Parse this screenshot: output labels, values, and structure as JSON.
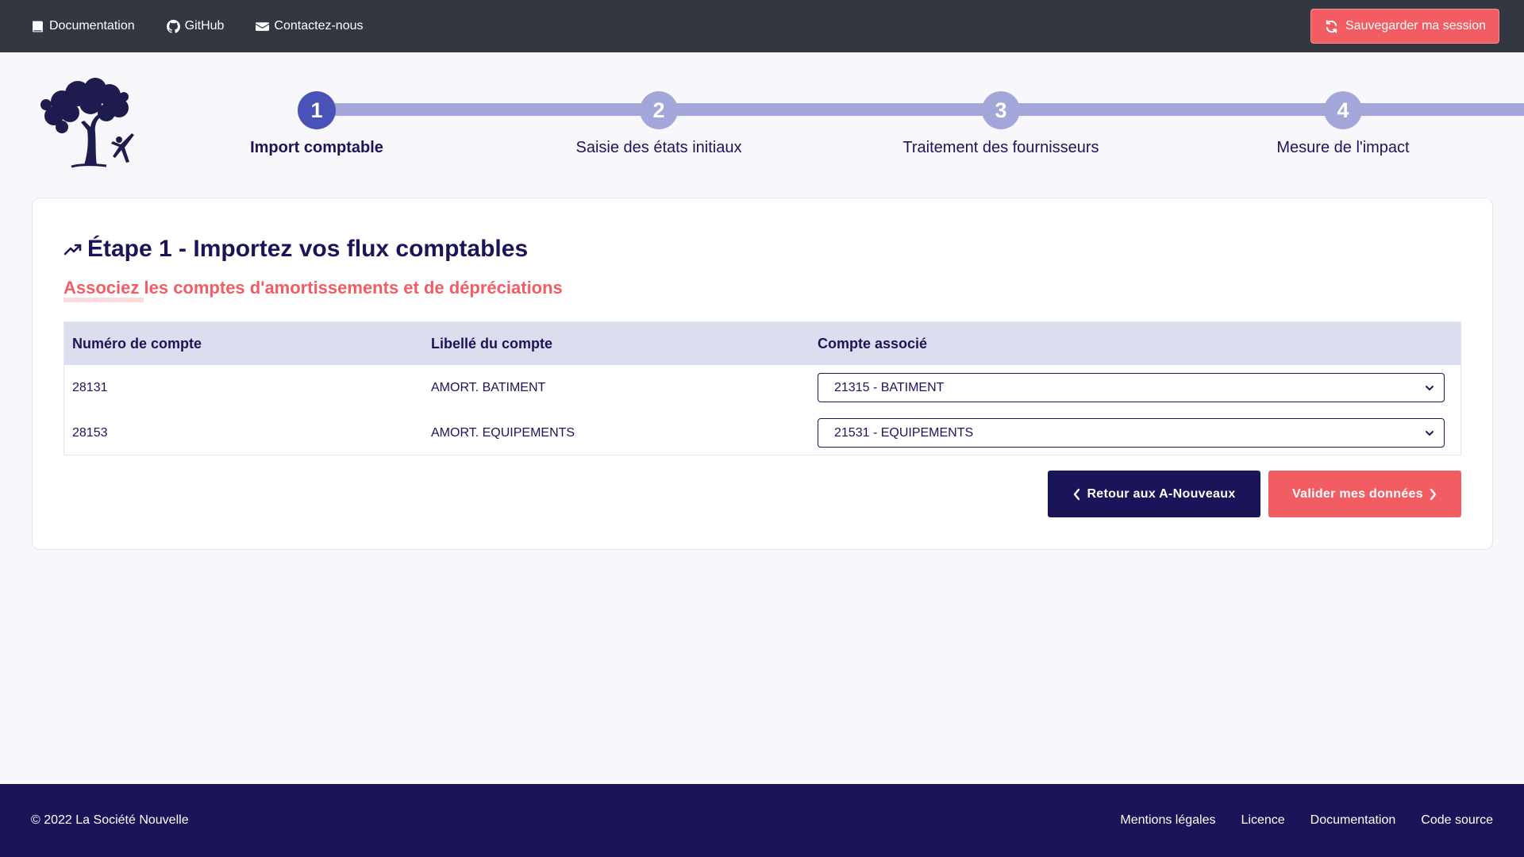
{
  "topbar": {
    "links": [
      {
        "label": "Documentation",
        "icon": "book-icon"
      },
      {
        "label": "GitHub",
        "icon": "github-icon"
      },
      {
        "label": "Contactez-nous",
        "icon": "envelope-icon"
      }
    ],
    "save_label": "Sauvegarder ma session",
    "save_icon": "refresh-icon"
  },
  "stepper": {
    "steps": [
      {
        "number": "1",
        "label": "Import comptable",
        "active": true
      },
      {
        "number": "2",
        "label": "Saisie des états initiaux",
        "active": false
      },
      {
        "number": "3",
        "label": "Traitement des fournisseurs",
        "active": false
      },
      {
        "number": "4",
        "label": "Mesure de l'impact",
        "active": false
      }
    ]
  },
  "card": {
    "title": "Étape 1 - Importez vos flux comptables",
    "title_icon": "trending-up-icon",
    "subtitle": "Associez les comptes d'amortissements et de dépréciations",
    "table": {
      "headers": [
        "Numéro de compte",
        "Libellé du compte",
        "Compte associé"
      ],
      "rows": [
        {
          "account": "28131",
          "label": "AMORT. BATIMENT",
          "associated": "21315 - BATIMENT"
        },
        {
          "account": "28153",
          "label": "AMORT. EQUIPEMENTS",
          "associated": "21531 - EQUIPEMENTS"
        }
      ]
    },
    "back_label": "Retour aux A-Nouveaux",
    "next_label": "Valider mes données"
  },
  "footer": {
    "copyright": "© 2022 La Société Nouvelle",
    "links": [
      "Mentions légales",
      "Licence",
      "Documentation",
      "Code source"
    ]
  },
  "colors": {
    "navy": "#191558",
    "coral": "#f25c63",
    "topbar": "#33373f",
    "step_active": "#4a52b8",
    "step_inactive": "#a3a6d8",
    "table_header": "#dcdef0"
  }
}
